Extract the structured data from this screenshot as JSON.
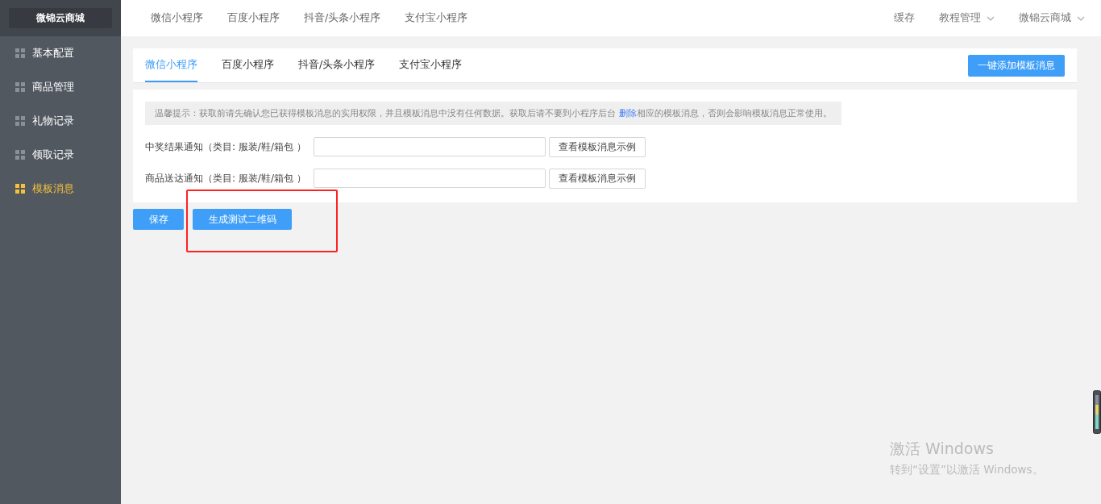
{
  "sidebar": {
    "logo": "微锦云商城",
    "items": [
      {
        "label": "基本配置",
        "selected": false
      },
      {
        "label": "商品管理",
        "selected": false
      },
      {
        "label": "礼物记录",
        "selected": false
      },
      {
        "label": "领取记录",
        "selected": false
      },
      {
        "label": "模板消息",
        "selected": true
      }
    ]
  },
  "top_nav": {
    "tabs": [
      {
        "label": "微信小程序"
      },
      {
        "label": "百度小程序"
      },
      {
        "label": "抖音/头条小程序"
      },
      {
        "label": "支付宝小程序"
      }
    ],
    "right": [
      {
        "label": "缓存",
        "dropdown": false
      },
      {
        "label": "教程管理",
        "dropdown": true
      },
      {
        "label": "微锦云商城",
        "dropdown": true
      }
    ]
  },
  "tabs": [
    {
      "label": "微信小程序",
      "selected": true
    },
    {
      "label": "百度小程序",
      "selected": false
    },
    {
      "label": "抖音/头条小程序",
      "selected": false
    },
    {
      "label": "支付宝小程序",
      "selected": false
    }
  ],
  "add_button": "一键添加模板消息",
  "notice": {
    "before": "温馨提示：获取前请先确认您已获得模板消息的实用权限，并且模板消息中没有任何数据。获取后请不要到小程序后台 ",
    "link": "删除",
    "after": "相应的模板消息，否则会影响模板消息正常使用。"
  },
  "fields": [
    {
      "label": "中奖结果通知（类目: 服装/鞋/箱包 ）",
      "button": "查看模板消息示例"
    },
    {
      "label": "商品送达通知（类目: 服装/鞋/箱包 ）",
      "button": "查看模板消息示例"
    }
  ],
  "actions": [
    "保存",
    "生成测试二维码"
  ],
  "activation": {
    "title": "激活 Windows",
    "subtitle": "转到“设置”以激活 Windows。"
  }
}
